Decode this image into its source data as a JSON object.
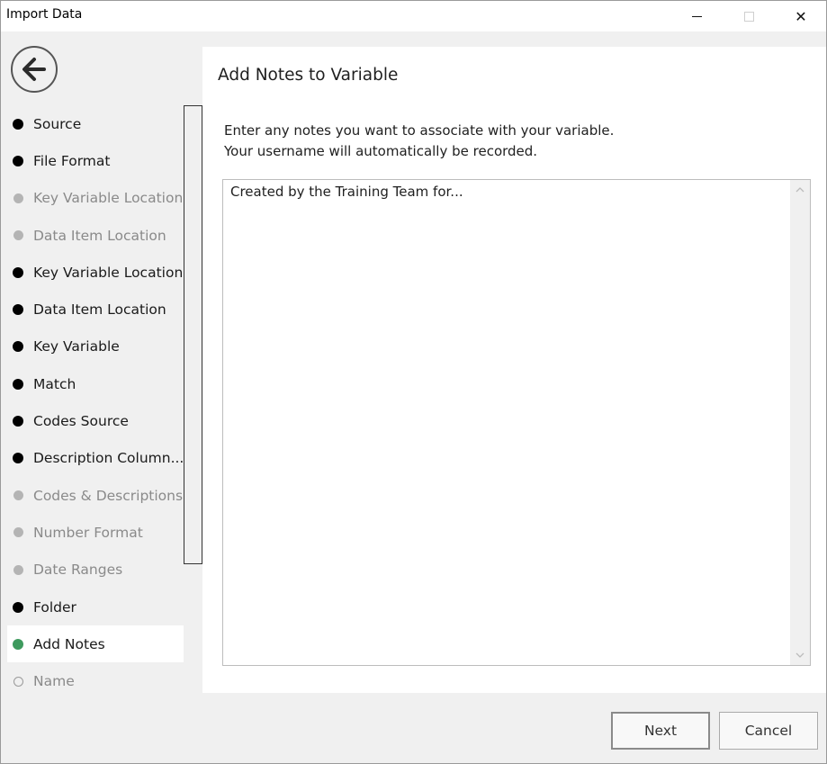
{
  "window": {
    "title": "Import Data",
    "controls": {
      "minimize": "minimize",
      "maximize": "maximize",
      "close": "✕"
    }
  },
  "nav": {
    "back_icon": "back-arrow-icon"
  },
  "steps": [
    {
      "label": "Source",
      "state": "done"
    },
    {
      "label": "File Format",
      "state": "done"
    },
    {
      "label": "Key Variable Location",
      "state": "skip"
    },
    {
      "label": "Data Item Location",
      "state": "skip"
    },
    {
      "label": "Key Variable Location",
      "state": "done"
    },
    {
      "label": "Data Item Location",
      "state": "done"
    },
    {
      "label": "Key Variable",
      "state": "done"
    },
    {
      "label": "Match",
      "state": "done"
    },
    {
      "label": "Codes Source",
      "state": "done"
    },
    {
      "label": "Description  Column...",
      "state": "done"
    },
    {
      "label": "Codes & Descriptions",
      "state": "skip"
    },
    {
      "label": "Number Format",
      "state": "skip"
    },
    {
      "label": "Date Ranges",
      "state": "skip"
    },
    {
      "label": "Folder",
      "state": "done"
    },
    {
      "label": "Add Notes",
      "state": "current"
    },
    {
      "label": "Name",
      "state": "pending"
    }
  ],
  "content": {
    "title": "Add Notes to Variable",
    "instructions_line1": "Enter any notes you want to associate with your variable.",
    "instructions_line2": "Your username will automatically be recorded.",
    "notes_value": "Created by the Training Team for..."
  },
  "buttons": {
    "next": "Next",
    "cancel": "Cancel"
  },
  "colors": {
    "current_step": "#3e9a5e",
    "completed_step": "#000000",
    "skipped_step": "#b4b4b4"
  }
}
